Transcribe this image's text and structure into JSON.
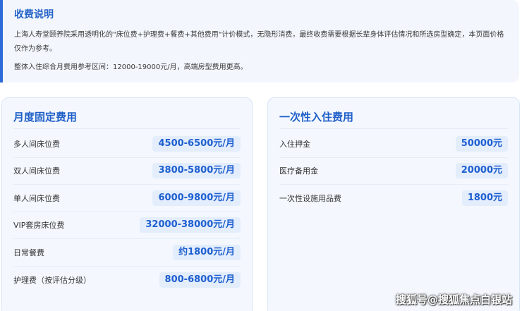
{
  "notice": {
    "title": "收费说明",
    "paragraph1": "上海人寿堂颐养院采用透明化的\"床位费+护理费+餐费+其他费用\"计价模式，无隐形消费，最终收费需要根据长辈身体评估情况和所选房型确定，本页面价格仅作为参考。",
    "paragraph2": "整体入住综合月费用参考区间：12000-19000元/月，高端房型费用更高。"
  },
  "monthly": {
    "title": "月度固定费用",
    "rows": [
      {
        "label": "多人间床位费",
        "price": "4500-6500元/月"
      },
      {
        "label": "双人间床位费",
        "price": "3800-5800元/月"
      },
      {
        "label": "单人间床位费",
        "price": "6000-9800元/月"
      },
      {
        "label": "VIP套房床位费",
        "price": "32000-38000元/月"
      },
      {
        "label": "日常餐费",
        "price": "约1800元/月"
      },
      {
        "label": "护理费（按评估分级）",
        "price": "800-6800元/月"
      }
    ]
  },
  "onetime": {
    "title": "一次性入住费用",
    "rows": [
      {
        "label": "入住押金",
        "price": "50000元"
      },
      {
        "label": "医疗备用金",
        "price": "20000元"
      },
      {
        "label": "一次性设施用品费",
        "price": "1800元"
      }
    ]
  },
  "watermark": "搜狐号@搜狐焦点白银站"
}
